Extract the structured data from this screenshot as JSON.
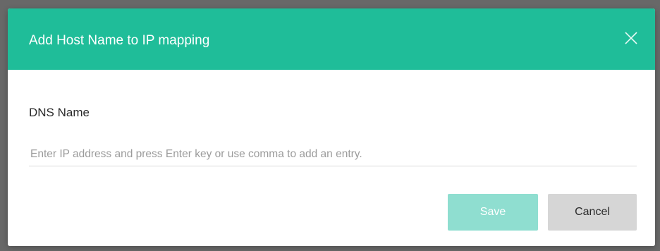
{
  "dialog": {
    "title": "Add Host Name to IP mapping",
    "close_icon": "close-icon",
    "field_label": "DNS Name",
    "input_value": "",
    "input_placeholder": "Enter IP address and press Enter key or use comma to add an entry.",
    "save_label": "Save",
    "save_disabled": true,
    "cancel_label": "Cancel"
  },
  "colors": {
    "header_bg": "#1fbd99",
    "save_bg_disabled": "#8fded0",
    "cancel_bg": "#d6d6d6",
    "backdrop": "#686868"
  }
}
